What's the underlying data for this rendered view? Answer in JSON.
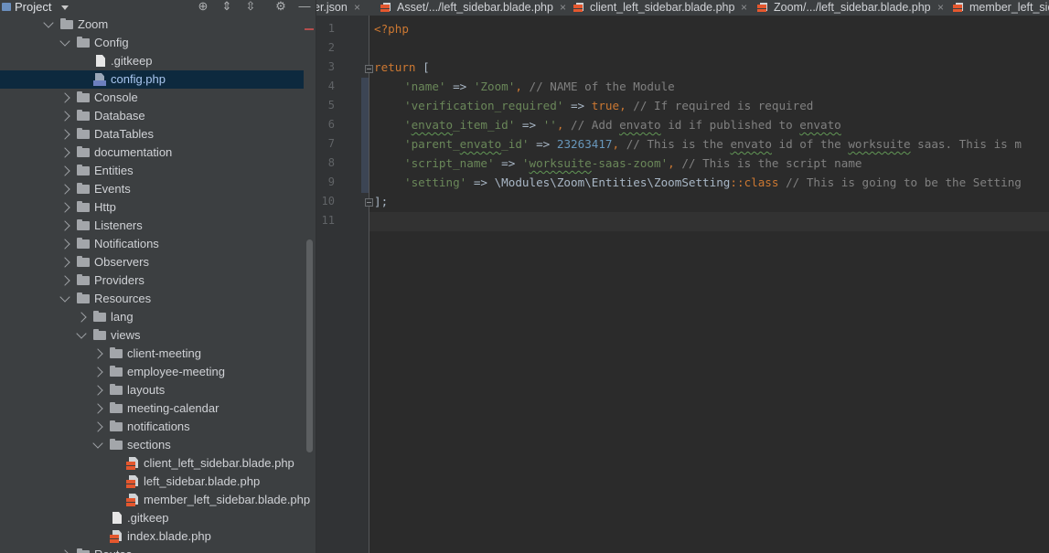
{
  "project_header": {
    "title": "Project"
  },
  "tree": [
    {
      "label": "Zoom",
      "kind": "folder",
      "state": "expanded",
      "depth": 2,
      "name": "tree-folder-zoom"
    },
    {
      "label": "Config",
      "kind": "folder",
      "state": "expanded",
      "depth": 3,
      "name": "tree-folder-config"
    },
    {
      "label": ".gitkeep",
      "kind": "file",
      "depth": 4,
      "name": "tree-file-gitkeep-config"
    },
    {
      "label": "config.php",
      "kind": "php",
      "depth": 4,
      "selected": true,
      "name": "tree-file-config-php"
    },
    {
      "label": "Console",
      "kind": "folder",
      "state": "collapsed",
      "depth": 3,
      "name": "tree-folder-console"
    },
    {
      "label": "Database",
      "kind": "folder",
      "state": "collapsed",
      "depth": 3,
      "name": "tree-folder-database"
    },
    {
      "label": "DataTables",
      "kind": "folder",
      "state": "collapsed",
      "depth": 3,
      "name": "tree-folder-datatables"
    },
    {
      "label": "documentation",
      "kind": "folder",
      "state": "collapsed",
      "depth": 3,
      "name": "tree-folder-documentation"
    },
    {
      "label": "Entities",
      "kind": "folder",
      "state": "collapsed",
      "depth": 3,
      "name": "tree-folder-entities"
    },
    {
      "label": "Events",
      "kind": "folder",
      "state": "collapsed",
      "depth": 3,
      "name": "tree-folder-events"
    },
    {
      "label": "Http",
      "kind": "folder",
      "state": "collapsed",
      "depth": 3,
      "name": "tree-folder-http"
    },
    {
      "label": "Listeners",
      "kind": "folder",
      "state": "collapsed",
      "depth": 3,
      "name": "tree-folder-listeners"
    },
    {
      "label": "Notifications",
      "kind": "folder",
      "state": "collapsed",
      "depth": 3,
      "name": "tree-folder-notifications"
    },
    {
      "label": "Observers",
      "kind": "folder",
      "state": "collapsed",
      "depth": 3,
      "name": "tree-folder-observers"
    },
    {
      "label": "Providers",
      "kind": "folder",
      "state": "collapsed",
      "depth": 3,
      "name": "tree-folder-providers"
    },
    {
      "label": "Resources",
      "kind": "folder",
      "state": "expanded",
      "depth": 3,
      "name": "tree-folder-resources"
    },
    {
      "label": "lang",
      "kind": "folder",
      "state": "collapsed",
      "depth": 4,
      "name": "tree-folder-lang"
    },
    {
      "label": "views",
      "kind": "folder",
      "state": "expanded",
      "depth": 4,
      "name": "tree-folder-views"
    },
    {
      "label": "client-meeting",
      "kind": "folder",
      "state": "collapsed",
      "depth": 5,
      "name": "tree-folder-client-meeting"
    },
    {
      "label": "employee-meeting",
      "kind": "folder",
      "state": "collapsed",
      "depth": 5,
      "name": "tree-folder-employee-meeting"
    },
    {
      "label": "layouts",
      "kind": "folder",
      "state": "collapsed",
      "depth": 5,
      "name": "tree-folder-layouts"
    },
    {
      "label": "meeting-calendar",
      "kind": "folder",
      "state": "collapsed",
      "depth": 5,
      "name": "tree-folder-meeting-calendar"
    },
    {
      "label": "notifications",
      "kind": "folder",
      "state": "collapsed",
      "depth": 5,
      "name": "tree-folder-notifications-views"
    },
    {
      "label": "sections",
      "kind": "folder",
      "state": "expanded",
      "depth": 5,
      "name": "tree-folder-sections"
    },
    {
      "label": "client_left_sidebar.blade.php",
      "kind": "blade",
      "depth": 6,
      "name": "tree-file-client-left-sidebar"
    },
    {
      "label": "left_sidebar.blade.php",
      "kind": "blade",
      "depth": 6,
      "name": "tree-file-left-sidebar"
    },
    {
      "label": "member_left_sidebar.blade.php",
      "kind": "blade",
      "depth": 6,
      "name": "tree-file-member-left-sidebar"
    },
    {
      "label": ".gitkeep",
      "kind": "file",
      "depth": 5,
      "name": "tree-file-gitkeep-views"
    },
    {
      "label": "index.blade.php",
      "kind": "blade",
      "depth": 5,
      "name": "tree-file-index-blade"
    },
    {
      "label": "Routes",
      "kind": "folder",
      "state": "collapsed",
      "depth": 3,
      "name": "tree-folder-routes"
    }
  ],
  "tabs": [
    {
      "label": "er.json",
      "icon": "none",
      "name": "tab-json"
    },
    {
      "label": "Asset/.../left_sidebar.blade.php",
      "icon": "blade",
      "name": "tab-asset-left-sidebar"
    },
    {
      "label": "client_left_sidebar.blade.php",
      "icon": "blade",
      "name": "tab-client-left-sidebar"
    },
    {
      "label": "Zoom/.../left_sidebar.blade.php",
      "icon": "blade",
      "name": "tab-zoom-left-sidebar"
    },
    {
      "label": "member_left_sid",
      "icon": "blade",
      "name": "tab-member-left-sidebar"
    }
  ],
  "line_numbers": [
    "1",
    "2",
    "3",
    "4",
    "5",
    "6",
    "7",
    "8",
    "9",
    "10",
    "11"
  ],
  "code": {
    "l1": "<?php",
    "l3_kw": "return",
    "l3_rest": " [",
    "l4_key": "'name'",
    "l4_arrow": " => ",
    "l4_val": "'Zoom'",
    "l4_comma": ", ",
    "l4_com": "// NAME of the Module",
    "l5_key": "'verification_required'",
    "l5_arrow": " => ",
    "l5_val": "true",
    "l5_comma": ", ",
    "l5_com": "// If required is required",
    "l6_key_a": "'",
    "l6_key_b": "envato",
    "l6_key_c": "_item_id'",
    "l6_arrow": " => ",
    "l6_val": "''",
    "l6_comma": ", ",
    "l6_com_a": "// Add ",
    "l6_com_b": "envato",
    "l6_com_c": " id if published to ",
    "l6_com_d": "envato",
    "l7_key_a": "'parent_",
    "l7_key_b": "envato",
    "l7_key_c": "_id'",
    "l7_arrow": " => ",
    "l7_val": "23263417",
    "l7_comma": ", ",
    "l7_com_a": "// This is the ",
    "l7_com_b": "envato",
    "l7_com_c": " id of the ",
    "l7_com_d": "worksuite",
    "l7_com_e": " saas. This is m",
    "l8_key": "'script_name'",
    "l8_arrow": " => ",
    "l8_val_a": "'",
    "l8_val_b": "worksuite",
    "l8_val_c": "-saas-zoom'",
    "l8_comma": ", ",
    "l8_com": "// This is the script name",
    "l9_key": "'setting'",
    "l9_arrow": " => ",
    "l9_ns": "\\Modules\\Zoom\\Entities\\",
    "l9_cls": "ZoomSetting",
    "l9_dc": "::",
    "l9_kw": "class",
    "l9_sp": " ",
    "l9_com": "// This is going to be the Setting",
    "l10": "];"
  },
  "colors": {
    "keyword": "#cc7832",
    "string": "#6a8759",
    "number": "#6897bb",
    "comment": "#808080",
    "text": "#a9b7c6",
    "selection": "#0d293e"
  }
}
